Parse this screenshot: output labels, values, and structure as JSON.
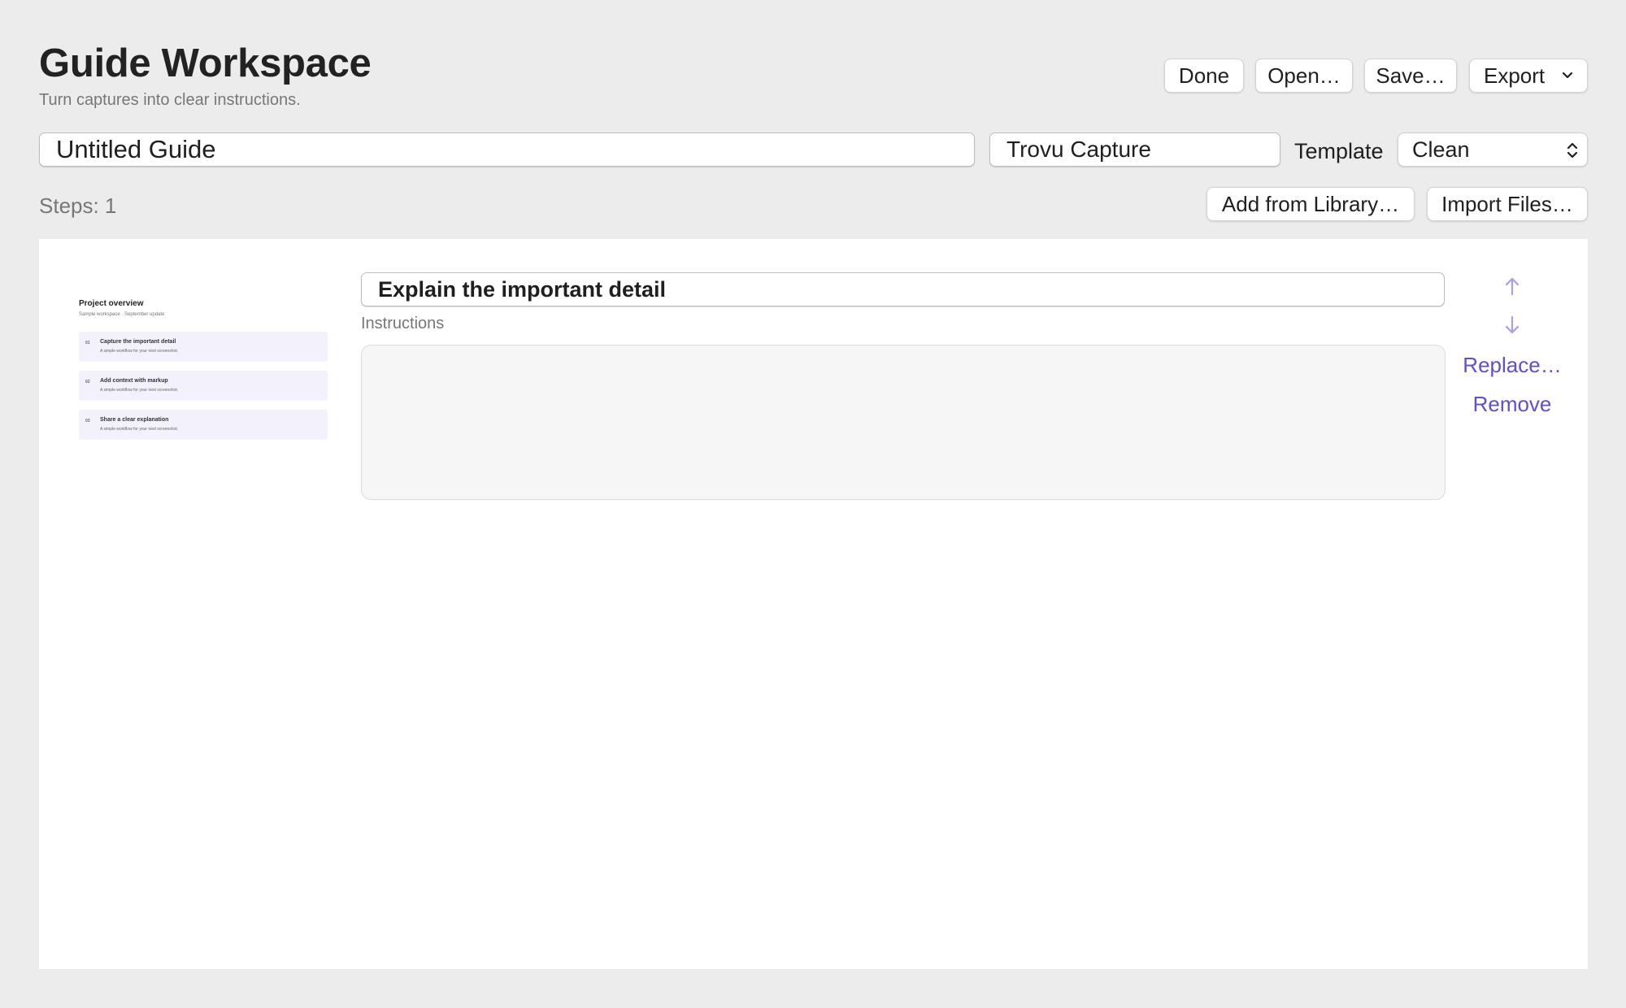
{
  "header": {
    "title": "Guide Workspace",
    "subtitle": "Turn captures into clear instructions."
  },
  "toolbar": {
    "done_label": "Done",
    "open_label": "Open…",
    "save_label": "Save…",
    "export_label": "Export"
  },
  "form": {
    "guide_title_value": "Untitled Guide",
    "app_name_value": "Trovu Capture",
    "template_label": "Template",
    "template_selected": "Clean"
  },
  "steps": {
    "count_label": "Steps: 1",
    "add_from_library_label": "Add from Library…",
    "import_files_label": "Import Files…"
  },
  "step": {
    "title_value": "Explain the important detail",
    "instructions_label": "Instructions",
    "instructions_value": "",
    "replace_label": "Replace…",
    "remove_label": "Remove",
    "thumbnail": {
      "title": "Project overview",
      "subtitle": "Sample workspace · September update",
      "rows": [
        {
          "num": "01",
          "title": "Capture the important detail",
          "desc": "A simple workflow for your next screenshot."
        },
        {
          "num": "02",
          "title": "Add context with markup",
          "desc": "A simple workflow for your next screenshot."
        },
        {
          "num": "03",
          "title": "Share a clear explanation",
          "desc": "A simple workflow for your next screenshot."
        }
      ]
    }
  },
  "icons": {
    "export_chevron": "chevron-down-icon",
    "template_updown": "updown-chevron-icon",
    "move_up": "arrow-up-icon",
    "move_down": "arrow-down-icon"
  },
  "colors": {
    "background": "#ececec",
    "canvas": "#ffffff",
    "accent": "#5d4fd8",
    "arrow": "#a89ef0",
    "thumbnail_row": "#f3f1fb"
  }
}
